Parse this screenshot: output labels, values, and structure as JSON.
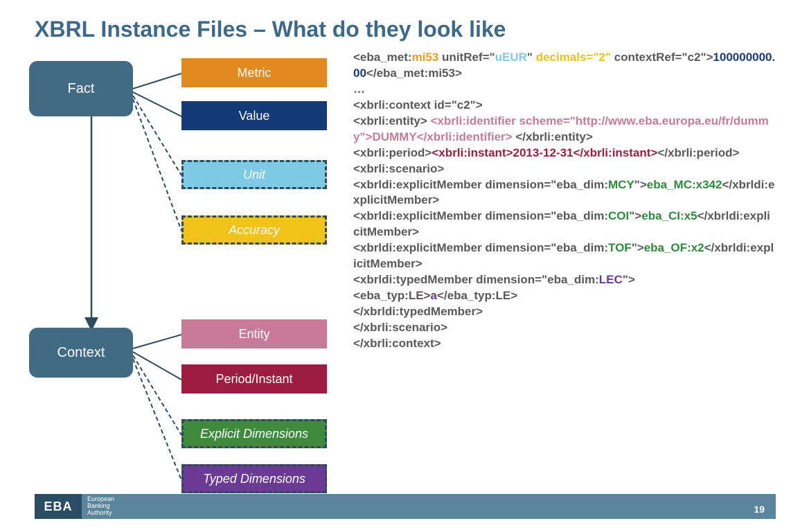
{
  "title": "XBRL Instance Files – What do they look like",
  "diagram": {
    "fact": "Fact",
    "context": "Context",
    "metric": "Metric",
    "value": "Value",
    "unit": "Unit",
    "accuracy": "Accuracy",
    "entity": "Entity",
    "period": "Period/Instant",
    "explicit": "Explicit Dimensions",
    "typed": "Typed Dimensions"
  },
  "code": {
    "l1a": "<eba_met:",
    "l1b": "mi53",
    "l1c": " unitRef=\"",
    "l1d": "uEUR",
    "l1e": "\" ",
    "l1f": "decimals=\"2\"",
    "l1g": " contextRef=\"c2\">",
    "l1h": "100000000.00",
    "l1i": "</eba_met:mi53>",
    "l2": "…",
    "l3": "<xbrli:context id=\"c2\">",
    "l4a": " <xbrli:entity> ",
    "l4b": "<xbrli:identifier scheme=\"http://www.eba.europa.eu/fr/dummy\">DUMMY</xbrli:identifier>",
    "l4c": " </xbrli:entity>",
    "l5a": " <xbrli:period>",
    "l5b": "<xbrli:instant>2013-12-31</xbrli:instant>",
    "l5c": "</xbrli:period>",
    "l6": " <xbrli:scenario>",
    "l7a": "  <xbrldi:explicitMember dimension=\"eba_dim:",
    "l7b": "MCY",
    "l7c": "\">",
    "l7d": "eba_MC:x342",
    "l7e": "</xbrldi:explicitMember>",
    "l8a": "  <xbrldi:explicitMember dimension=\"eba_dim:",
    "l8b": "COI",
    "l8c": "\">",
    "l8d": "eba_CI:x5",
    "l8e": "</xbrldi:explicitMember>",
    "l9a": "  <xbrldi:explicitMember dimension=\"eba_dim:",
    "l9b": "TOF",
    "l9c": "\">",
    "l9d": "eba_OF:x2",
    "l9e": "</xbrldi:explicitMember>",
    "l10a": "<xbrldi:typedMember dimension=\"eba_dim:",
    "l10b": "LEC",
    "l10c": "\">",
    "l11a": "      <eba_typ:LE>",
    "l11b": "a",
    "l11c": "</eba_typ:LE>",
    "l12": "    </xbrldi:typedMember>",
    "l13": " </xbrli:scenario>",
    "l14": "</xbrli:context>"
  },
  "footer": {
    "logo": "EBA",
    "org1": "European",
    "org2": "Banking",
    "org3": "Authority",
    "page": "19"
  }
}
